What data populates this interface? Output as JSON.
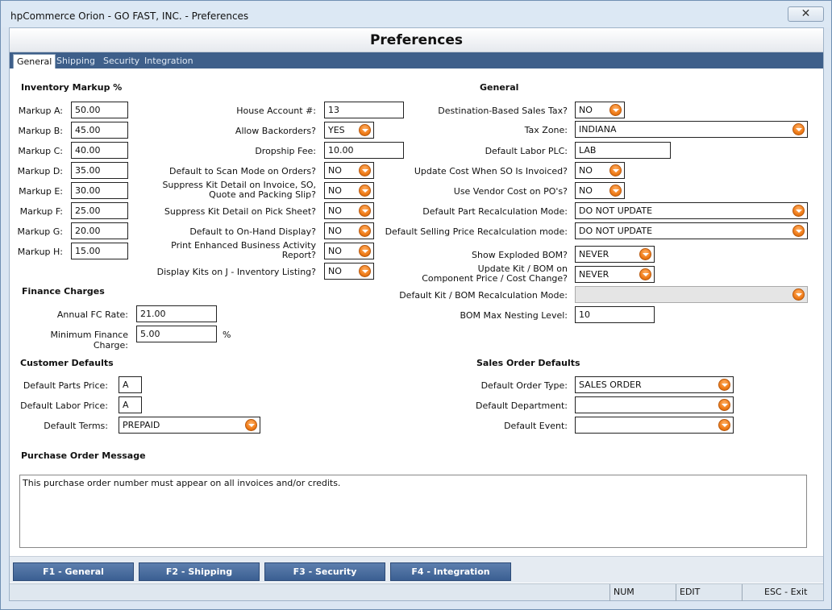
{
  "window": {
    "title": "hpCommerce Orion - GO FAST, INC. - Preferences",
    "close_icon": "close-icon"
  },
  "page_title": "Preferences",
  "tabs": [
    "General",
    "Shipping",
    "Security",
    "Integration"
  ],
  "active_tab": "General",
  "inventory_markup": {
    "heading": "Inventory Markup %",
    "rows": [
      {
        "label": "Markup A:",
        "value": "50.00"
      },
      {
        "label": "Markup B:",
        "value": "45.00"
      },
      {
        "label": "Markup C:",
        "value": "40.00"
      },
      {
        "label": "Markup D:",
        "value": "35.00"
      },
      {
        "label": "Markup E:",
        "value": "30.00"
      },
      {
        "label": "Markup F:",
        "value": "25.00"
      },
      {
        "label": "Markup G:",
        "value": "20.00"
      },
      {
        "label": "Markup H:",
        "value": "15.00"
      }
    ]
  },
  "middle": {
    "house_account_label": "House Account #:",
    "house_account_value": "13",
    "allow_backorders_label": "Allow Backorders?",
    "allow_backorders_value": "YES",
    "dropship_fee_label": "Dropship Fee:",
    "dropship_fee_value": "10.00",
    "scan_mode_label": "Default to Scan Mode on Orders?",
    "scan_mode_value": "NO",
    "suppress_kit_invoice_label_1": "Suppress Kit Detail on Invoice, SO,",
    "suppress_kit_invoice_label_2": "Quote and Packing Slip?",
    "suppress_kit_invoice_value": "NO",
    "suppress_kit_pick_label": "Suppress Kit Detail on Pick Sheet?",
    "suppress_kit_pick_value": "NO",
    "onhand_display_label": "Default to On-Hand Display?",
    "onhand_display_value": "NO",
    "enhanced_report_label_1": "Print Enhanced Business Activity",
    "enhanced_report_label_2": "Report?",
    "enhanced_report_value": "NO",
    "display_kits_label": "Display Kits on J - Inventory Listing?",
    "display_kits_value": "NO"
  },
  "general": {
    "heading": "General",
    "dest_tax_label": "Destination-Based Sales Tax?",
    "dest_tax_value": "NO",
    "tax_zone_label": "Tax Zone:",
    "tax_zone_value": "INDIANA",
    "labor_plc_label": "Default Labor PLC:",
    "labor_plc_value": "LAB",
    "update_cost_label": "Update Cost When SO Is Invoiced?",
    "update_cost_value": "NO",
    "vendor_cost_label": "Use Vendor Cost on PO's?",
    "vendor_cost_value": "NO",
    "part_recalc_label": "Default Part Recalculation Mode:",
    "part_recalc_value": "DO NOT UPDATE",
    "selling_recalc_label": "Default Selling Price Recalculation mode:",
    "selling_recalc_value": "DO NOT UPDATE",
    "exploded_bom_label": "Show Exploded BOM?",
    "exploded_bom_value": "NEVER",
    "update_kit_label_1": "Update Kit / BOM on",
    "update_kit_label_2": "Component Price / Cost Change?",
    "update_kit_value": "NEVER",
    "kit_recalc_label": "Default Kit / BOM Recalculation Mode:",
    "kit_recalc_value": "",
    "bom_nesting_label": "BOM Max Nesting Level:",
    "bom_nesting_value": "10"
  },
  "finance": {
    "heading": "Finance Charges",
    "annual_rate_label": "Annual FC Rate:",
    "annual_rate_value": "21.00",
    "min_charge_label": "Minimum Finance Charge:",
    "min_charge_value": "5.00",
    "min_charge_unit": "%"
  },
  "customer_defaults": {
    "heading": "Customer Defaults",
    "parts_price_label": "Default Parts Price:",
    "parts_price_value": "A",
    "labor_price_label": "Default Labor Price:",
    "labor_price_value": "A",
    "terms_label": "Default Terms:",
    "terms_value": "PREPAID"
  },
  "sales_order_defaults": {
    "heading": "Sales Order Defaults",
    "order_type_label": "Default Order Type:",
    "order_type_value": "SALES ORDER",
    "department_label": "Default Department:",
    "department_value": "",
    "event_label": "Default Event:",
    "event_value": ""
  },
  "po_message": {
    "heading": "Purchase Order Message",
    "text": "This purchase order number must appear on all invoices and/or credits."
  },
  "function_buttons": [
    "F1 - General",
    "F2 - Shipping",
    "F3 - Security",
    "F4 - Integration"
  ],
  "status_bar": {
    "num": "NUM",
    "mode": "EDIT",
    "exit": "ESC - Exit"
  },
  "colors": {
    "tab_bar": "#3e5f8a",
    "button": "#3b5f92",
    "dropdown_accent": "#f07d1a"
  },
  "icons": {
    "dropdown": "chevron-down-icon",
    "close": "close-icon"
  }
}
